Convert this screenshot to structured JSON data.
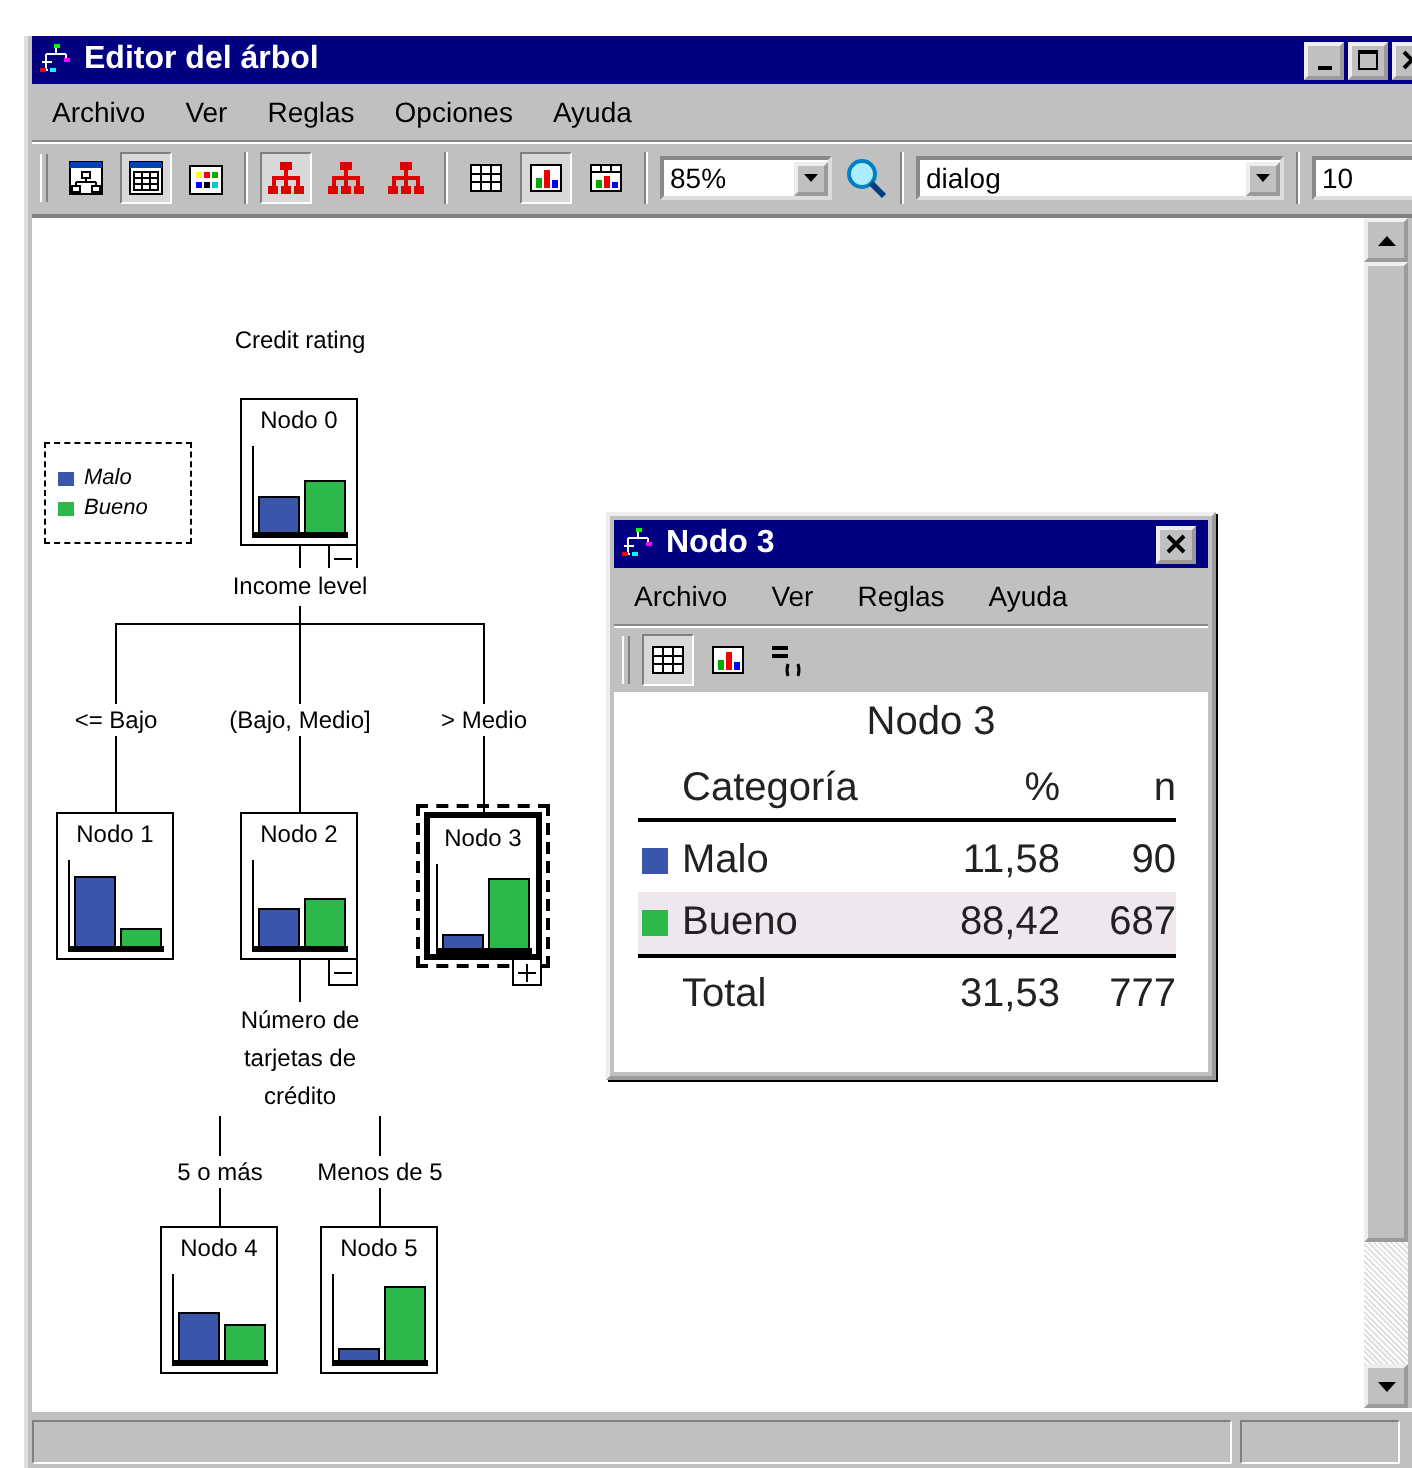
{
  "window": {
    "title": "Editor del árbol"
  },
  "menu": [
    "Archivo",
    "Ver",
    "Reglas",
    "Opciones",
    "Ayuda"
  ],
  "toolbar": {
    "buttons": [
      {
        "pressed": false
      },
      {
        "pressed": true
      },
      {
        "pressed": false
      },
      {
        "pressed": true
      },
      {
        "pressed": false
      },
      {
        "pressed": false
      },
      {
        "pressed": false
      },
      {
        "pressed": true
      },
      {
        "pressed": false
      }
    ],
    "zoom": "85%",
    "font": "dialog",
    "font_size": "10"
  },
  "legend": [
    {
      "label": "Malo",
      "color": "#3a56ab"
    },
    {
      "label": "Bueno",
      "color": "#2db84c"
    }
  ],
  "tree": {
    "title": "Credit rating",
    "root": {
      "label": "Nodo 0",
      "selected": false,
      "expanded": true,
      "split": "Income level",
      "children": [
        {
          "branch": "<= Bajo",
          "label": "Nodo 1",
          "selected": false
        },
        {
          "branch": "(Bajo, Medio]",
          "label": "Nodo 2",
          "selected": false,
          "expanded": true,
          "split": "Número de tarjetas de crédito",
          "children": [
            {
              "branch": "5 o más",
              "label": "Nodo 4",
              "selected": false
            },
            {
              "branch": "Menos de 5",
              "label": "Nodo 5",
              "selected": false
            }
          ]
        },
        {
          "branch": "> Medio",
          "label": "Nodo 3",
          "selected": true,
          "expanded": false
        }
      ]
    }
  },
  "popup": {
    "title": "Nodo 3",
    "menu": [
      "Archivo",
      "Ver",
      "Reglas",
      "Ayuda"
    ],
    "toolbar": [
      {
        "pressed": true
      },
      {
        "pressed": false
      },
      {
        "pressed": false
      }
    ],
    "heading": "Nodo 3",
    "columns": [
      "Categoría",
      "%",
      "n"
    ],
    "rows": [
      {
        "category": "Malo",
        "percent": "11,58",
        "n": "90",
        "selected": false
      },
      {
        "category": "Bueno",
        "percent": "88,42",
        "n": "687",
        "selected": true
      }
    ],
    "total": {
      "label": "Total",
      "percent": "31,53",
      "n": "777"
    }
  }
}
